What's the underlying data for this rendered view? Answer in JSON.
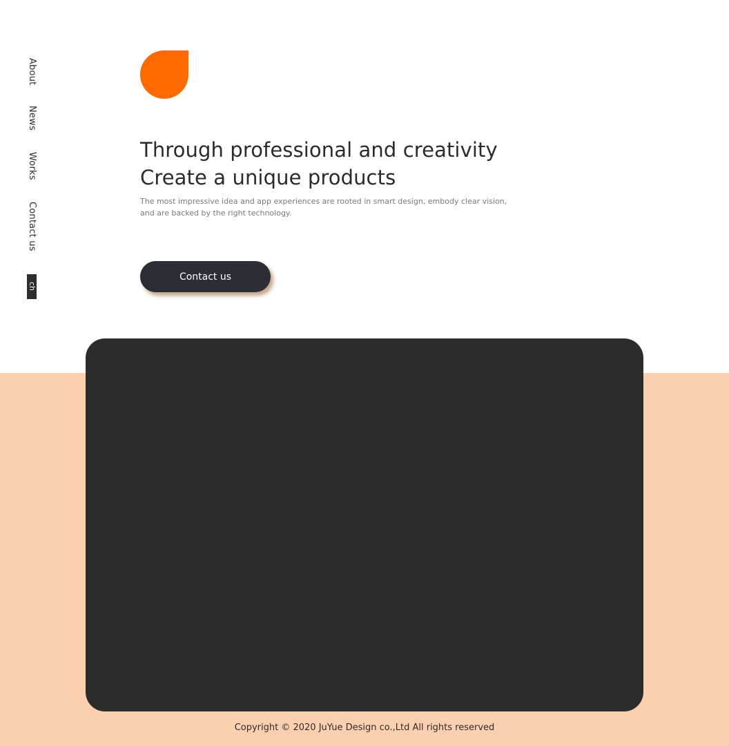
{
  "nav": {
    "items": [
      {
        "label": "About"
      },
      {
        "label": "News"
      },
      {
        "label": "Works"
      },
      {
        "label": "Contact us"
      }
    ],
    "lang_label": "ch"
  },
  "hero": {
    "title_line1": "Through professional and creativity",
    "title_line2": "Create a unique products",
    "desc_line1": "The most impressive idea and app experiences are rooted in smart design, embody clear vision,",
    "desc_line2": "and are backed by the right technology.",
    "cta_label": "Contact us"
  },
  "footer": {
    "copyright": "Copyright © 2020 JuYue Design co.,Ltd All rights reserved"
  },
  "colors": {
    "accent": "#ff6a00",
    "dark": "#2b2e35",
    "panel": "#2c2c2c",
    "peach": "#fccfae"
  }
}
